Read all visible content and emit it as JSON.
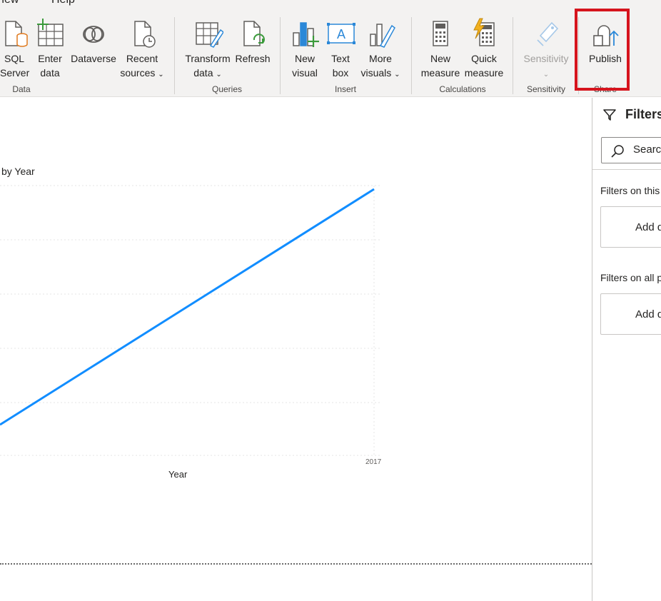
{
  "menu": {
    "view_label": "View",
    "help_label": "Help"
  },
  "ribbon": {
    "data_group": {
      "label": "Data",
      "sql_server": {
        "line1": "SQL",
        "line2": "Server"
      },
      "enter_data": {
        "line1": "Enter",
        "line2": "data"
      },
      "dataverse": {
        "line1": "Dataverse"
      },
      "recent_sources": {
        "line1": "Recent",
        "line2": "sources"
      }
    },
    "queries_group": {
      "label": "Queries",
      "transform_data": {
        "line1": "Transform",
        "line2": "data"
      },
      "refresh": {
        "line1": "Refresh"
      }
    },
    "insert_group": {
      "label": "Insert",
      "new_visual": {
        "line1": "New",
        "line2": "visual"
      },
      "text_box": {
        "line1": "Text",
        "line2": "box"
      },
      "more_visuals": {
        "line1": "More",
        "line2": "visuals"
      }
    },
    "calculations_group": {
      "label": "Calculations",
      "new_measure": {
        "line1": "New",
        "line2": "measure"
      },
      "quick_measure": {
        "line1": "Quick",
        "line2": "measure"
      }
    },
    "sensitivity_group": {
      "label": "Sensitivity",
      "sensitivity": {
        "line1": "Sensitivity"
      }
    },
    "share_group": {
      "label": "Share",
      "publish": {
        "line1": "Publish"
      }
    },
    "chevron": "⌄",
    "colors": {
      "highlight": "#d6141d"
    }
  },
  "chart": {
    "title": "by Year",
    "xlabel": "Year",
    "xtick": "2017"
  },
  "chart_data": {
    "type": "line",
    "title": "by Year",
    "xlabel": "Year",
    "ylabel": "",
    "x": [
      "2017"
    ],
    "series": [
      {
        "color": "#118dff",
        "trend": "increasing"
      }
    ],
    "grid": true,
    "legend": "none"
  },
  "filters": {
    "title": "Filters",
    "search_placeholder": "Search",
    "on_this_page": "Filters on this page",
    "on_all_pages": "Filters on all pages",
    "add_data_1": "Add data fields here",
    "add_data_2": "Add data fields here"
  }
}
